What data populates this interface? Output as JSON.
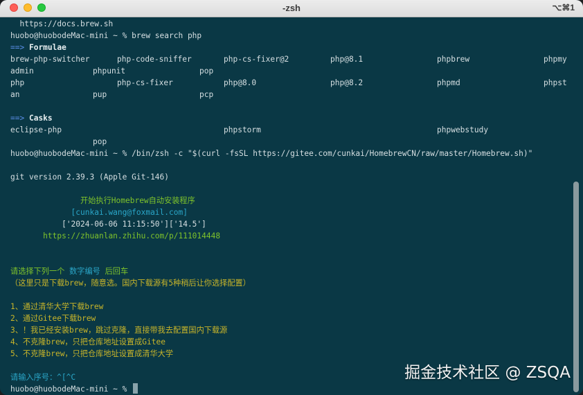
{
  "window": {
    "title": "-zsh",
    "shortcut": "⌥⌘1"
  },
  "terminal": {
    "url_line": "  https://docs.brew.sh",
    "cmd1_prompt": "huobo@huobodeMac-mini ~ % ",
    "cmd1_command": "brew search php",
    "formulae_arrow": "==>",
    "formulae_header": "Formulae",
    "formulae_rows": [
      [
        "brew-php-switcher",
        "php-code-sniffer",
        "php-cs-fixer@2",
        "php@8.1",
        "phpbrew",
        "phpmy"
      ],
      [
        "admin",
        "phpunit",
        "pop",
        "",
        "",
        ""
      ],
      [
        "php",
        "php-cs-fixer",
        "php@8.0",
        "php@8.2",
        "phpmd",
        "phpst"
      ],
      [
        "an",
        "pup",
        "pcp",
        "",
        "",
        ""
      ]
    ],
    "casks_arrow": "==>",
    "casks_header": "Casks",
    "casks_row1": [
      "eclipse-php",
      "phpstorm",
      "phpwebstudy"
    ],
    "casks_row2": "pop",
    "cmd2_prompt": "huobo@huobodeMac-mini ~ % ",
    "cmd2_command": "/bin/zsh -c \"$(curl -fsSL https://gitee.com/cunkai/HomebrewCN/raw/master/Homebrew.sh)\"",
    "git_version": "git version 2.39.3 (Apple Git-146)",
    "banner_title": "               开始执行Homebrew自动安装程序",
    "banner_email": "             [cunkai.wang@foxmail.com]",
    "banner_date": "           ['2024-06-06 11:15:50']['14.5']",
    "banner_url": "       https://zhuanlan.zhihu.com/p/111014448",
    "choose_prefix": "请选择下列一个 ",
    "choose_highlight": "数字编号",
    "choose_suffix": " 后回车",
    "choose_note": "（这里只是下载brew，随意选。国内下载源有5种稍后让你选择配置）",
    "options": [
      "1、通过清华大学下载brew",
      "2、通过Gitee下载brew",
      "3、！我已经安装brew，跳过克隆，直接带我去配置国内下载源",
      "4、不克隆brew，只把仓库地址设置成Gitee",
      "5、不克隆brew，只把仓库地址设置成清华大学"
    ],
    "input_prompt": "请输入序号：^[^C",
    "final_prompt": "huobo@huobodeMac-mini ~ % "
  },
  "watermark": "掘金技术社区 @ ZSQA",
  "colors": {
    "background": "#0a3845",
    "text": "#d6dfe2",
    "arrow": "#5a8ee8",
    "green": "#7fc32b",
    "cyan": "#2aa6c8",
    "yellow": "#c8b52a"
  }
}
